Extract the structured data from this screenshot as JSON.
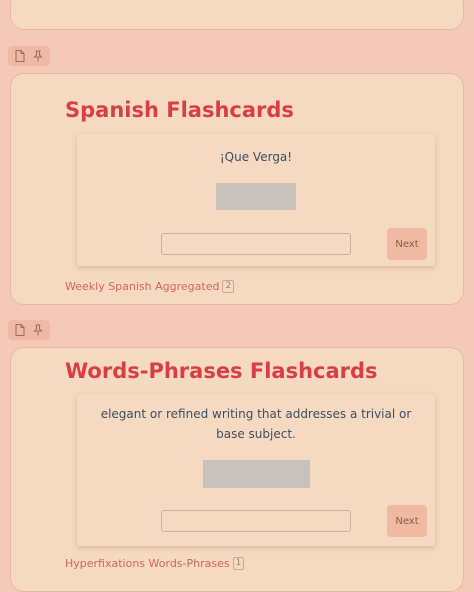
{
  "sections": [
    {
      "title": "Spanish Flashcards",
      "prompt": "¡Que Verga!",
      "answer_value": "",
      "answer_placeholder": "",
      "next_label": "Next",
      "deck_name": "Weekly Spanish Aggregated",
      "deck_count": "2"
    },
    {
      "title": "Words-Phrases Flashcards",
      "prompt": "elegant or refined writing that addresses a trivial or base subject.",
      "answer_value": "",
      "answer_placeholder": "",
      "next_label": "Next",
      "deck_name": "Hyperfixations Words-Phrases",
      "deck_count": "1"
    }
  ],
  "icons": {
    "toolbar": [
      "file-icon",
      "pin-icon"
    ]
  },
  "colors": {
    "page_bg": "#f4c9b7",
    "card_bg": "#f6d9c1",
    "title": "#d64045",
    "link": "#d1665c",
    "text": "#3d4f63",
    "button": "#f0b9a2"
  }
}
